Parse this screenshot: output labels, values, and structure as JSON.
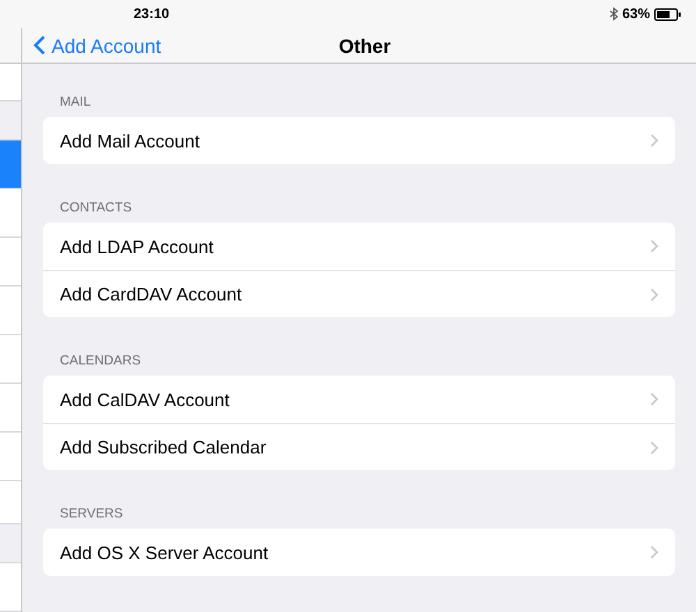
{
  "status_bar": {
    "time": "23:10",
    "battery": "63%"
  },
  "nav": {
    "back": "Add Account",
    "title": "Other"
  },
  "sidebar": {
    "rows": [
      {
        "kind": "partial",
        "selected": false
      },
      {
        "kind": "gap",
        "selected": false
      },
      {
        "kind": "row",
        "selected": true
      },
      {
        "kind": "row",
        "selected": false
      },
      {
        "kind": "row",
        "selected": false
      },
      {
        "kind": "row",
        "selected": false
      },
      {
        "kind": "row",
        "selected": false
      },
      {
        "kind": "row",
        "selected": false
      },
      {
        "kind": "row",
        "selected": false
      },
      {
        "kind": "short",
        "selected": false
      },
      {
        "kind": "gap",
        "selected": false
      },
      {
        "kind": "row",
        "selected": false
      }
    ]
  },
  "sections": [
    {
      "header": "MAIL",
      "items": [
        "Add Mail Account"
      ]
    },
    {
      "header": "CONTACTS",
      "items": [
        "Add LDAP Account",
        "Add CardDAV Account"
      ]
    },
    {
      "header": "CALENDARS",
      "items": [
        "Add CalDAV Account",
        "Add Subscribed Calendar"
      ]
    },
    {
      "header": "SERVERS",
      "items": [
        "Add OS X Server Account"
      ]
    }
  ]
}
